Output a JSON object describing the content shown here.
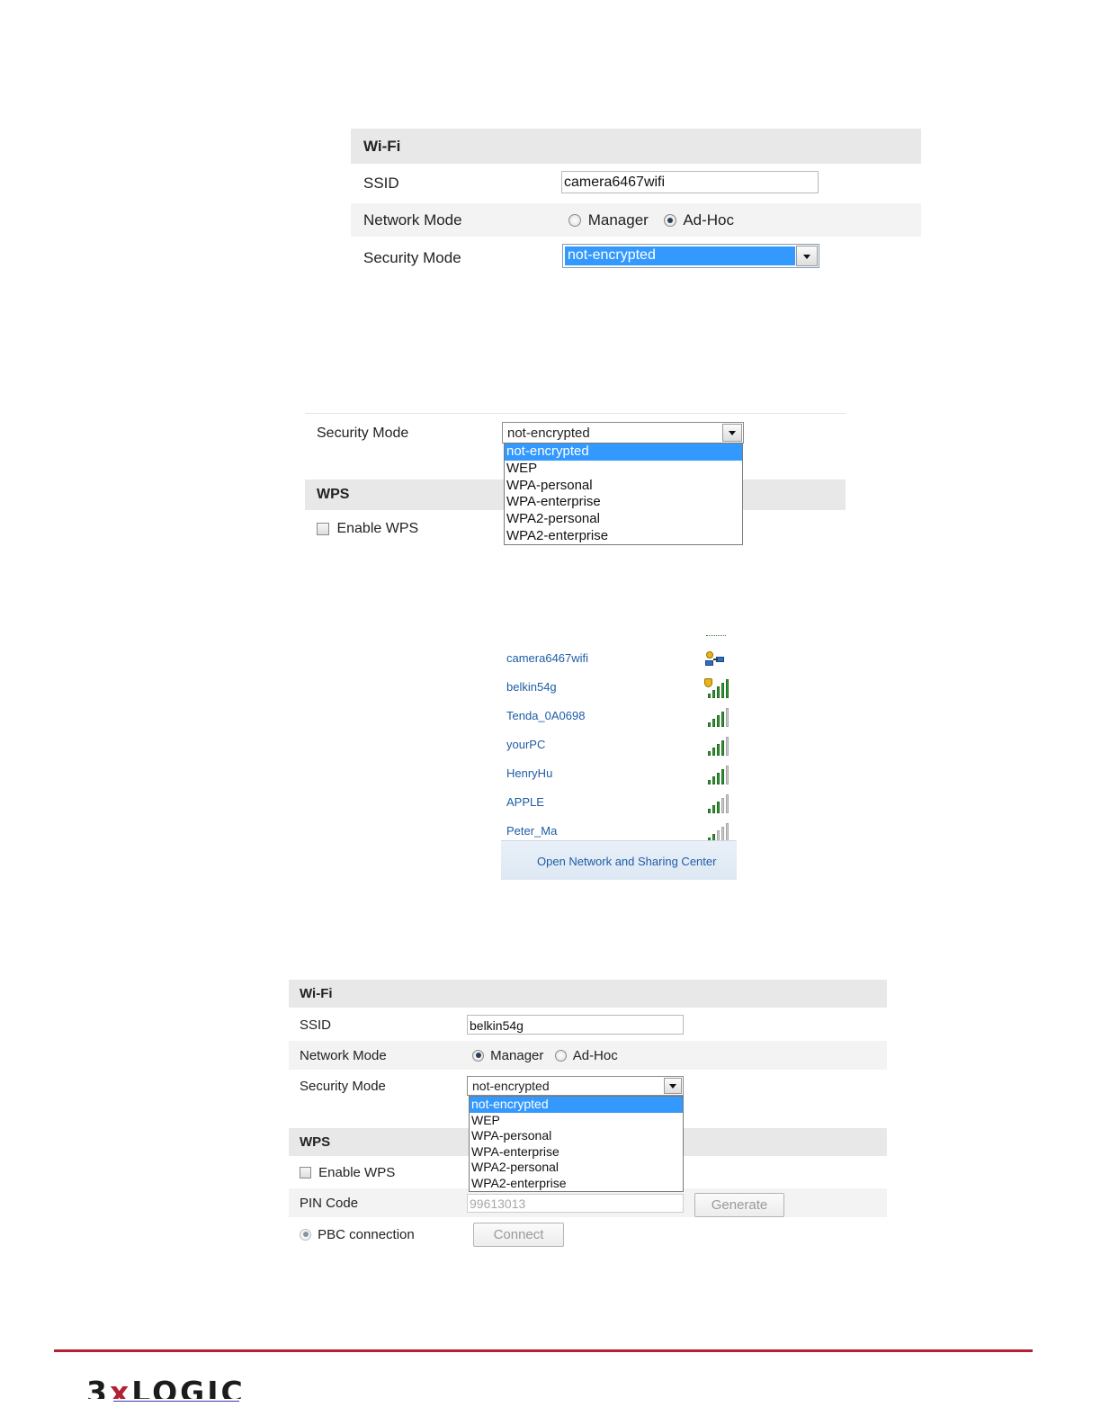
{
  "panel1": {
    "title": "Wi-Fi",
    "ssid_label": "SSID",
    "ssid_value": "camera6467wifi",
    "network_mode_label": "Network Mode",
    "manager_label": "Manager",
    "adhoc_label": "Ad-Hoc",
    "network_mode_selected": "Ad-Hoc",
    "security_mode_label": "Security Mode",
    "security_mode_value": "not-encrypted"
  },
  "panel2": {
    "security_mode_label": "Security Mode",
    "security_mode_value": "not-encrypted",
    "options": [
      "not-encrypted",
      "WEP",
      "WPA-personal",
      "WPA-enterprise",
      "WPA2-personal",
      "WPA2-enterprise"
    ],
    "selected_option": "not-encrypted",
    "wps_title": "WPS",
    "enable_wps_label": "Enable WPS"
  },
  "networks_panel": {
    "networks": [
      {
        "name": "camera6467wifi",
        "icon": "adhoc-network-icon"
      },
      {
        "name": "belkin54g",
        "icon": "secured-signal-full-icon"
      },
      {
        "name": "Tenda_0A0698",
        "icon": "signal-strong-icon"
      },
      {
        "name": "yourPC",
        "icon": "signal-strong-icon"
      },
      {
        "name": "HenryHu",
        "icon": "signal-strong-icon"
      },
      {
        "name": "APPLE",
        "icon": "signal-medium-icon"
      },
      {
        "name": "Peter_Ma",
        "icon": "signal-weak-icon"
      }
    ],
    "footer_link": "Open Network and Sharing Center"
  },
  "panel3": {
    "title": "Wi-Fi",
    "ssid_label": "SSID",
    "ssid_value": "belkin54g",
    "network_mode_label": "Network Mode",
    "manager_label": "Manager",
    "adhoc_label": "Ad-Hoc",
    "network_mode_selected": "Manager",
    "security_mode_label": "Security Mode",
    "security_mode_value": "not-encrypted",
    "options": [
      "not-encrypted",
      "WEP",
      "WPA-personal",
      "WPA-enterprise",
      "WPA2-personal",
      "WPA2-enterprise"
    ],
    "selected_option": "not-encrypted",
    "wps_title": "WPS",
    "enable_wps_label": "Enable WPS",
    "pin_code_label": "PIN Code",
    "pin_code_value": "99613013",
    "generate_label": "Generate",
    "pbc_label": "PBC connection",
    "connect_label": "Connect"
  },
  "footer": {
    "logo_text_a": "3",
    "logo_text_x": "x",
    "logo_text_b": "LOGIC",
    "colors": {
      "rule": "#b22234",
      "logo_accent": "#b22234"
    }
  },
  "colors": {
    "selection": "#3399ff",
    "section_bar": "#e8e8e8",
    "link": "#1e5ca6"
  }
}
